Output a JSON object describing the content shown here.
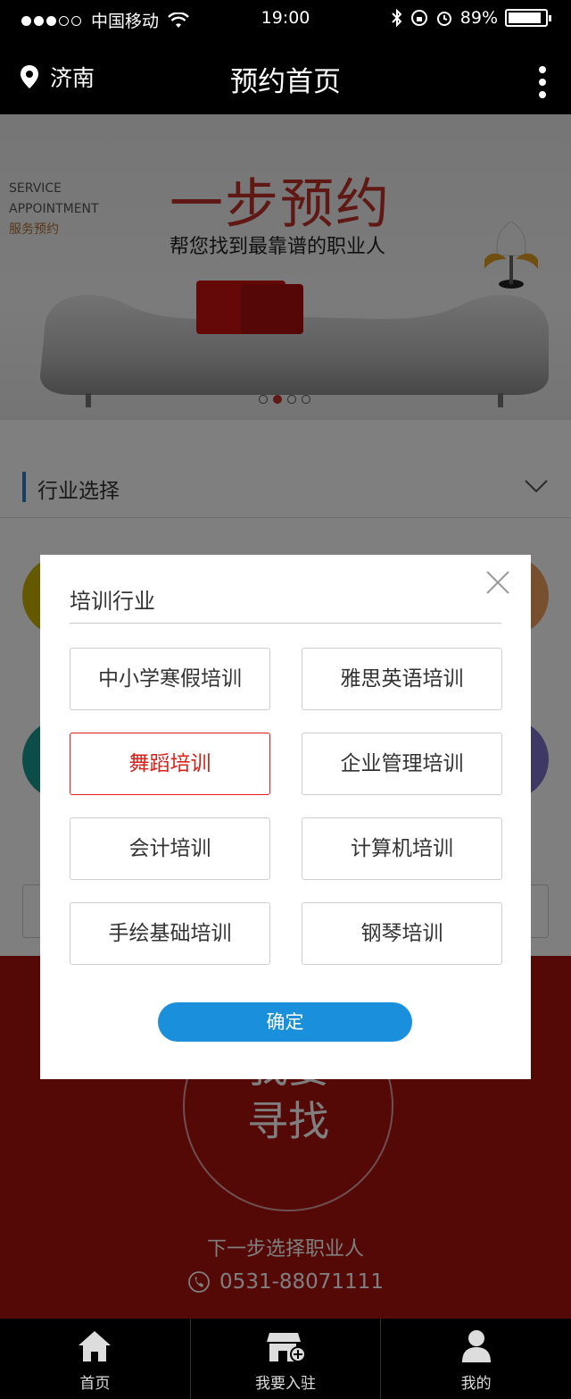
{
  "status_bar": {
    "carrier": "中国移动",
    "time": "19:00",
    "battery_percent": "89%",
    "battery_level": 0.89,
    "signal_dots_filled": 3,
    "signal_dots_total": 5
  },
  "nav": {
    "location": "济南",
    "title": "预约首页",
    "more_icon": "more-vertical-icon"
  },
  "banner": {
    "service_en_1": "SERVICE",
    "service_en_2": "APPOINTMENT",
    "service_cn": "服务预约",
    "headline": "一步预约",
    "subtitle": "帮您找到最靠谱的职业人",
    "slide_count": 4,
    "active_slide": 2
  },
  "section": {
    "title": "行业选择"
  },
  "bottom": {
    "find_label": "我要\n寻找",
    "find_visible": "寻找",
    "find_partial": "我要",
    "next_step": "下一步选择职业人",
    "phone": "0531-88071111"
  },
  "tabs": [
    {
      "label": "首页",
      "icon": "home-icon"
    },
    {
      "label": "我要入驻",
      "icon": "store-add-icon"
    },
    {
      "label": "我的",
      "icon": "user-icon"
    }
  ],
  "modal": {
    "title": "培训行业",
    "options": [
      {
        "label": "中小学寒假培训",
        "selected": false
      },
      {
        "label": "雅思英语培训",
        "selected": false
      },
      {
        "label": "舞蹈培训",
        "selected": true
      },
      {
        "label": "企业管理培训",
        "selected": false
      },
      {
        "label": "会计培训",
        "selected": false
      },
      {
        "label": "计算机培训",
        "selected": false
      },
      {
        "label": "手绘基础培训",
        "selected": false
      },
      {
        "label": "钢琴培训",
        "selected": false
      }
    ],
    "confirm": "确定"
  },
  "colors": {
    "accent_blue": "#1a8fdb",
    "selected_red": "#d9201b",
    "bottom_red": "#a8130e",
    "section_bar": "#2d7fc0"
  }
}
